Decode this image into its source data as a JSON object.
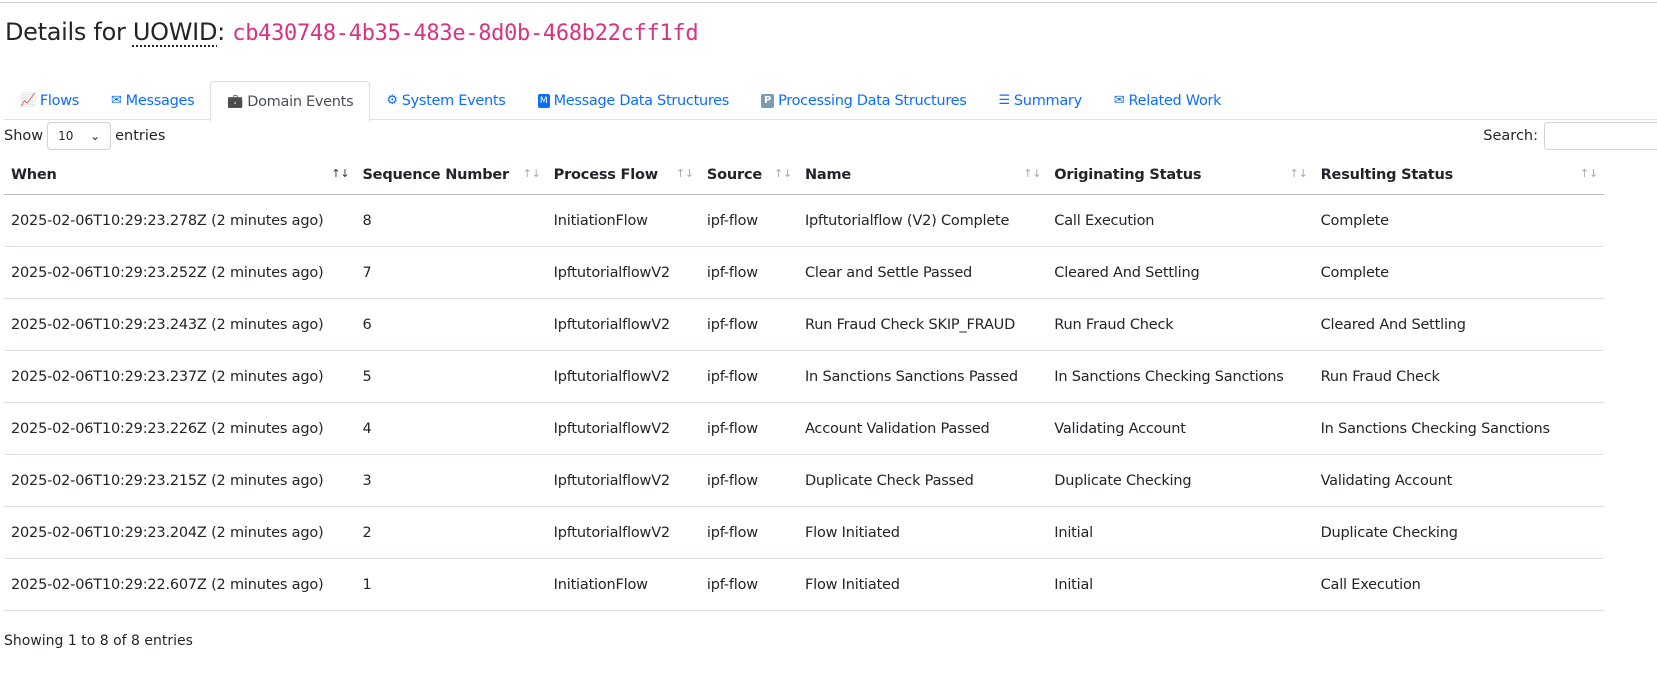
{
  "header": {
    "prefix": "Details for ",
    "abbr": "UOWID",
    "colon": ": ",
    "uowid": "cb430748-4b35-483e-8d0b-468b22cff1fd"
  },
  "tabs": [
    {
      "label": "Flows",
      "icon": "line-chart-icon",
      "active": false
    },
    {
      "label": "Messages",
      "icon": "envelope-icon",
      "active": false
    },
    {
      "label": "Domain Events",
      "icon": "briefcase-icon",
      "active": true
    },
    {
      "label": "System Events",
      "icon": "gear-icon",
      "active": false
    },
    {
      "label": "Message Data Structures",
      "icon": "m-badge-icon",
      "active": false
    },
    {
      "label": "Processing Data Structures",
      "icon": "p-badge-icon",
      "active": false
    },
    {
      "label": "Summary",
      "icon": "list-icon",
      "active": false
    },
    {
      "label": "Related Work",
      "icon": "envelope-filled-icon",
      "active": false
    }
  ],
  "length": {
    "show": "Show",
    "value": "10",
    "entries": "entries"
  },
  "search": {
    "label": "Search:",
    "value": ""
  },
  "table": {
    "columns": [
      "When",
      "Sequence Number",
      "Process Flow",
      "Source",
      "Name",
      "Originating Status",
      "Resulting Status"
    ],
    "rows": [
      [
        "2025-02-06T10:29:23.278Z (2 minutes ago)",
        "8",
        "InitiationFlow",
        "ipf-flow",
        "Ipftutorialflow (V2) Complete",
        "Call Execution",
        "Complete"
      ],
      [
        "2025-02-06T10:29:23.252Z (2 minutes ago)",
        "7",
        "IpftutorialflowV2",
        "ipf-flow",
        "Clear and Settle Passed",
        "Cleared And Settling",
        "Complete"
      ],
      [
        "2025-02-06T10:29:23.243Z (2 minutes ago)",
        "6",
        "IpftutorialflowV2",
        "ipf-flow",
        "Run Fraud Check SKIP_FRAUD",
        "Run Fraud Check",
        "Cleared And Settling"
      ],
      [
        "2025-02-06T10:29:23.237Z (2 minutes ago)",
        "5",
        "IpftutorialflowV2",
        "ipf-flow",
        "In Sanctions Sanctions Passed",
        "In Sanctions Checking Sanctions",
        "Run Fraud Check"
      ],
      [
        "2025-02-06T10:29:23.226Z (2 minutes ago)",
        "4",
        "IpftutorialflowV2",
        "ipf-flow",
        "Account Validation Passed",
        "Validating Account",
        "In Sanctions Checking Sanctions"
      ],
      [
        "2025-02-06T10:29:23.215Z (2 minutes ago)",
        "3",
        "IpftutorialflowV2",
        "ipf-flow",
        "Duplicate Check Passed",
        "Duplicate Checking",
        "Validating Account"
      ],
      [
        "2025-02-06T10:29:23.204Z (2 minutes ago)",
        "2",
        "IpftutorialflowV2",
        "ipf-flow",
        "Flow Initiated",
        "Initial",
        "Duplicate Checking"
      ],
      [
        "2025-02-06T10:29:22.607Z (2 minutes ago)",
        "1",
        "InitiationFlow",
        "ipf-flow",
        "Flow Initiated",
        "Initial",
        "Call Execution"
      ]
    ]
  },
  "info": "Showing 1 to 8 of 8 entries",
  "colors": {
    "link": "#0d6efd",
    "code": "#d63384"
  }
}
